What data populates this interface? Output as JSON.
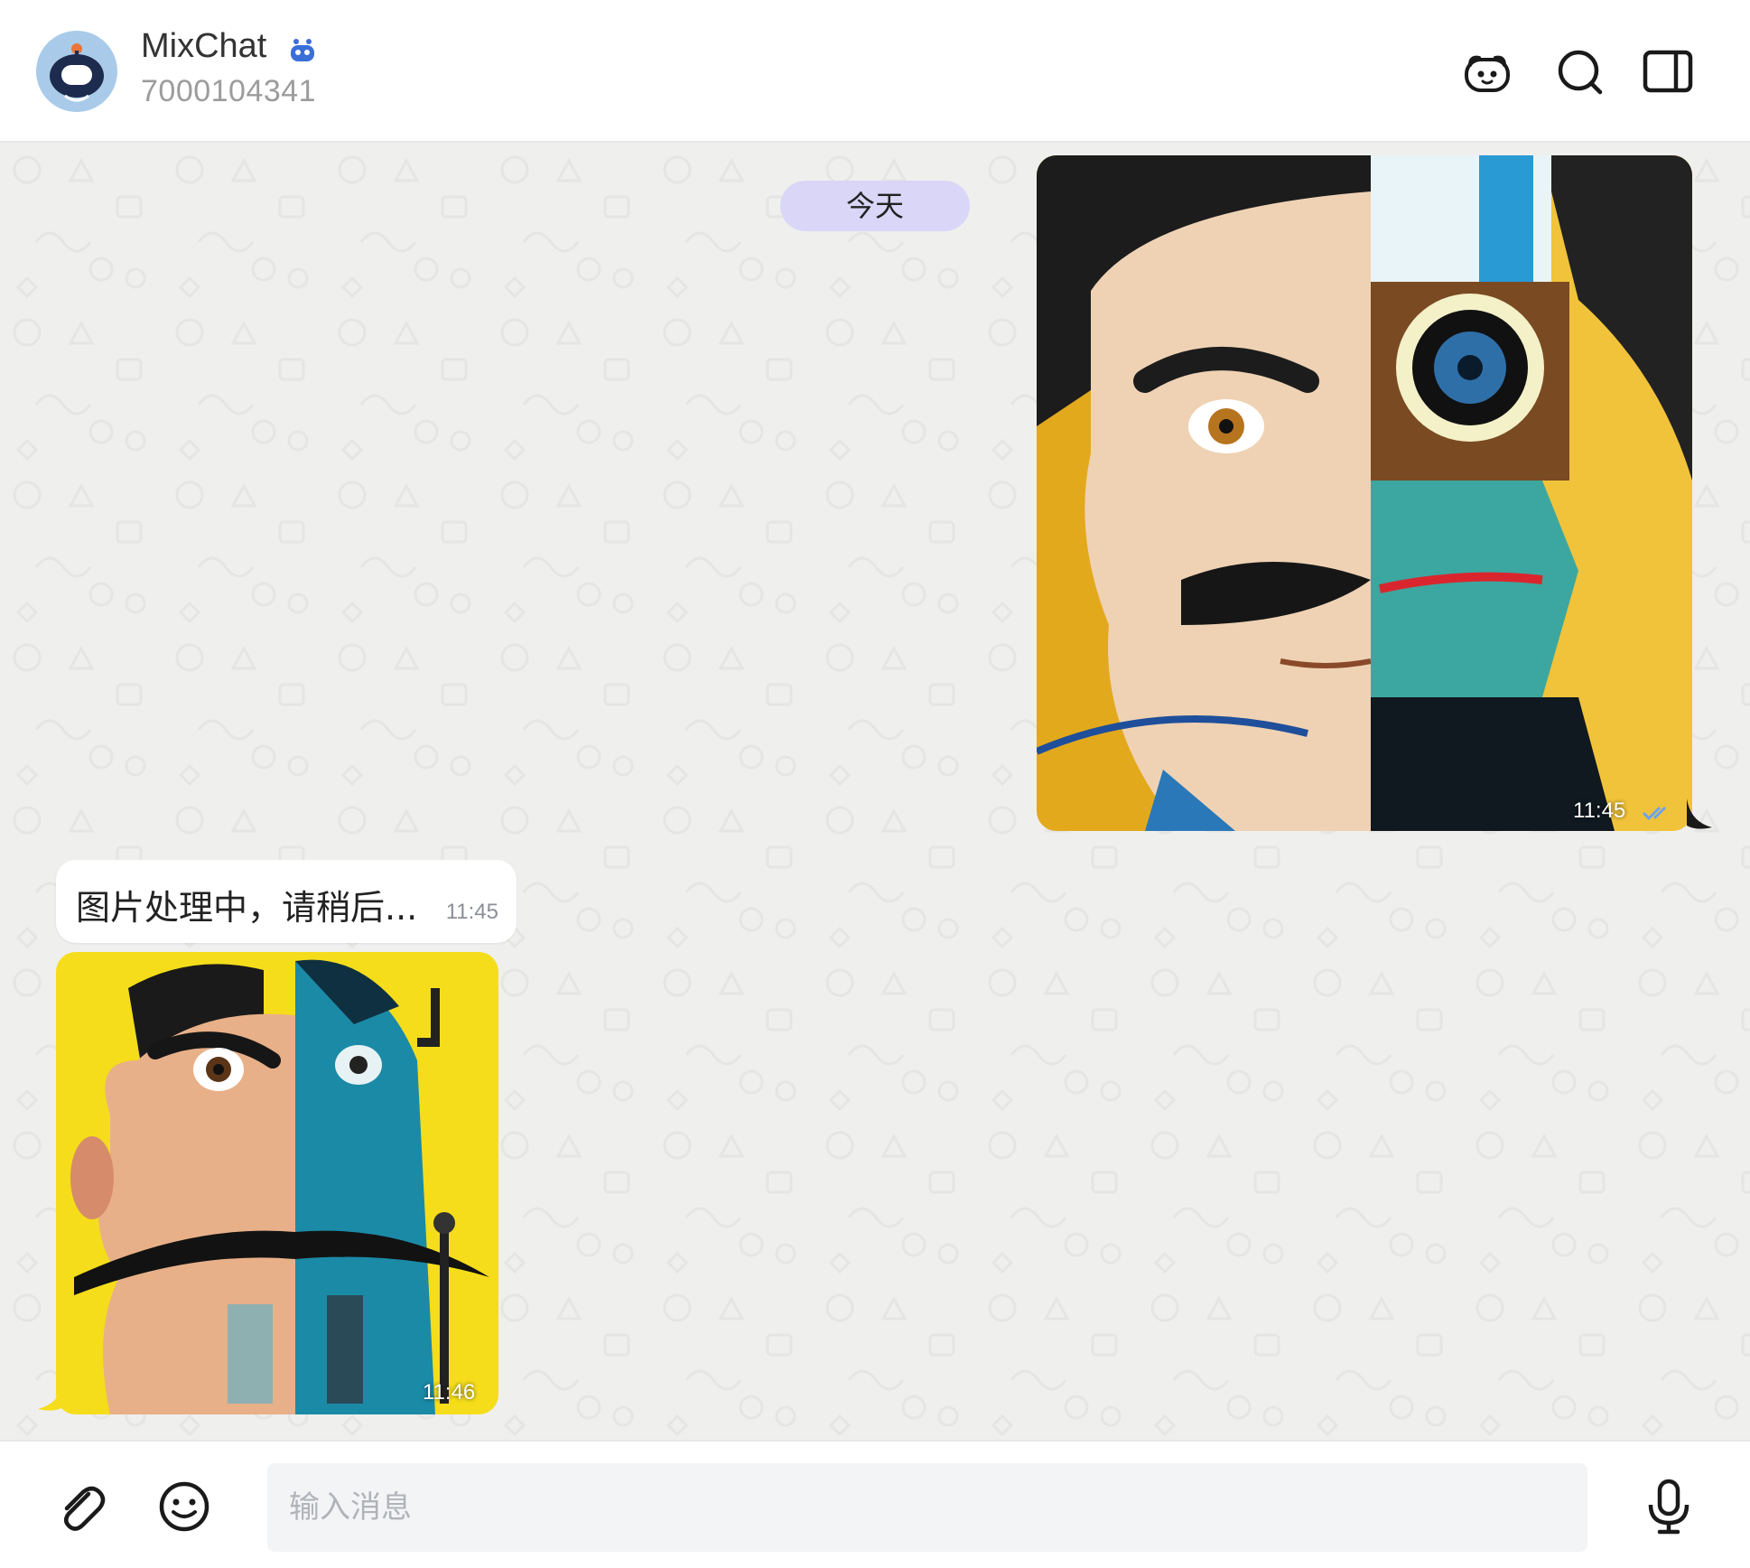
{
  "header": {
    "title": "MixChat",
    "subtitle": "7000104341",
    "avatar_icon": "robot-icon",
    "badge_icon": "bot-badge-icon",
    "actions": [
      {
        "name": "bot-menu-icon"
      },
      {
        "name": "search-icon"
      },
      {
        "name": "sidebar-toggle-icon"
      }
    ]
  },
  "chat": {
    "date_label": "今天",
    "messages": [
      {
        "direction": "outgoing",
        "type": "image",
        "time": "11:45",
        "status": "read"
      },
      {
        "direction": "incoming",
        "type": "text",
        "text": "图片处理中，请稍后...",
        "time": "11:45"
      },
      {
        "direction": "incoming",
        "type": "image",
        "time": "11:46"
      }
    ]
  },
  "composer": {
    "placeholder": "输入消息",
    "attach_icon": "paperclip-icon",
    "emoji_icon": "emoji-icon",
    "voice_icon": "microphone-icon"
  },
  "colors": {
    "accent": "#3b6fd8",
    "date_pill": "#d9d6f8",
    "avatar_bg": "#a9cbe9",
    "chat_bg": "#efefee"
  }
}
